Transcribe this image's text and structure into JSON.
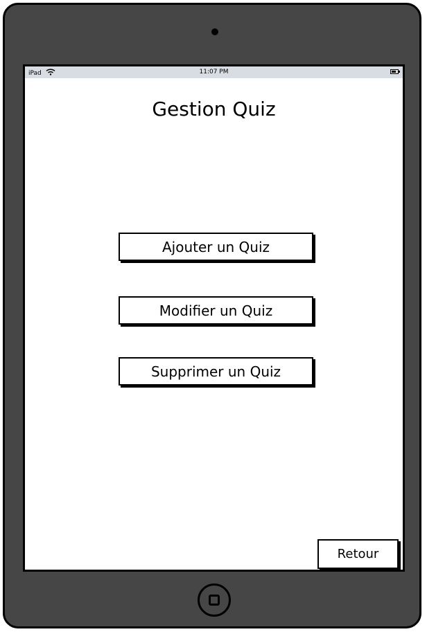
{
  "status_bar": {
    "device_label": "iPad",
    "time": "11:07 PM",
    "wifi_icon": "wifi-icon",
    "battery_icon": "battery-icon"
  },
  "page": {
    "title": "Gestion Quiz"
  },
  "menu": {
    "add_label": "Ajouter un Quiz",
    "edit_label": "Modifier un Quiz",
    "delete_label": "Supprimer un Quiz"
  },
  "footer": {
    "back_label": "Retour"
  },
  "device": {
    "home_icon": "home-button-icon",
    "camera_icon": "camera-icon"
  },
  "colors": {
    "frame": "#464646",
    "status_bar": "#d7dde2",
    "screen": "#ffffff",
    "outline": "#000000"
  }
}
